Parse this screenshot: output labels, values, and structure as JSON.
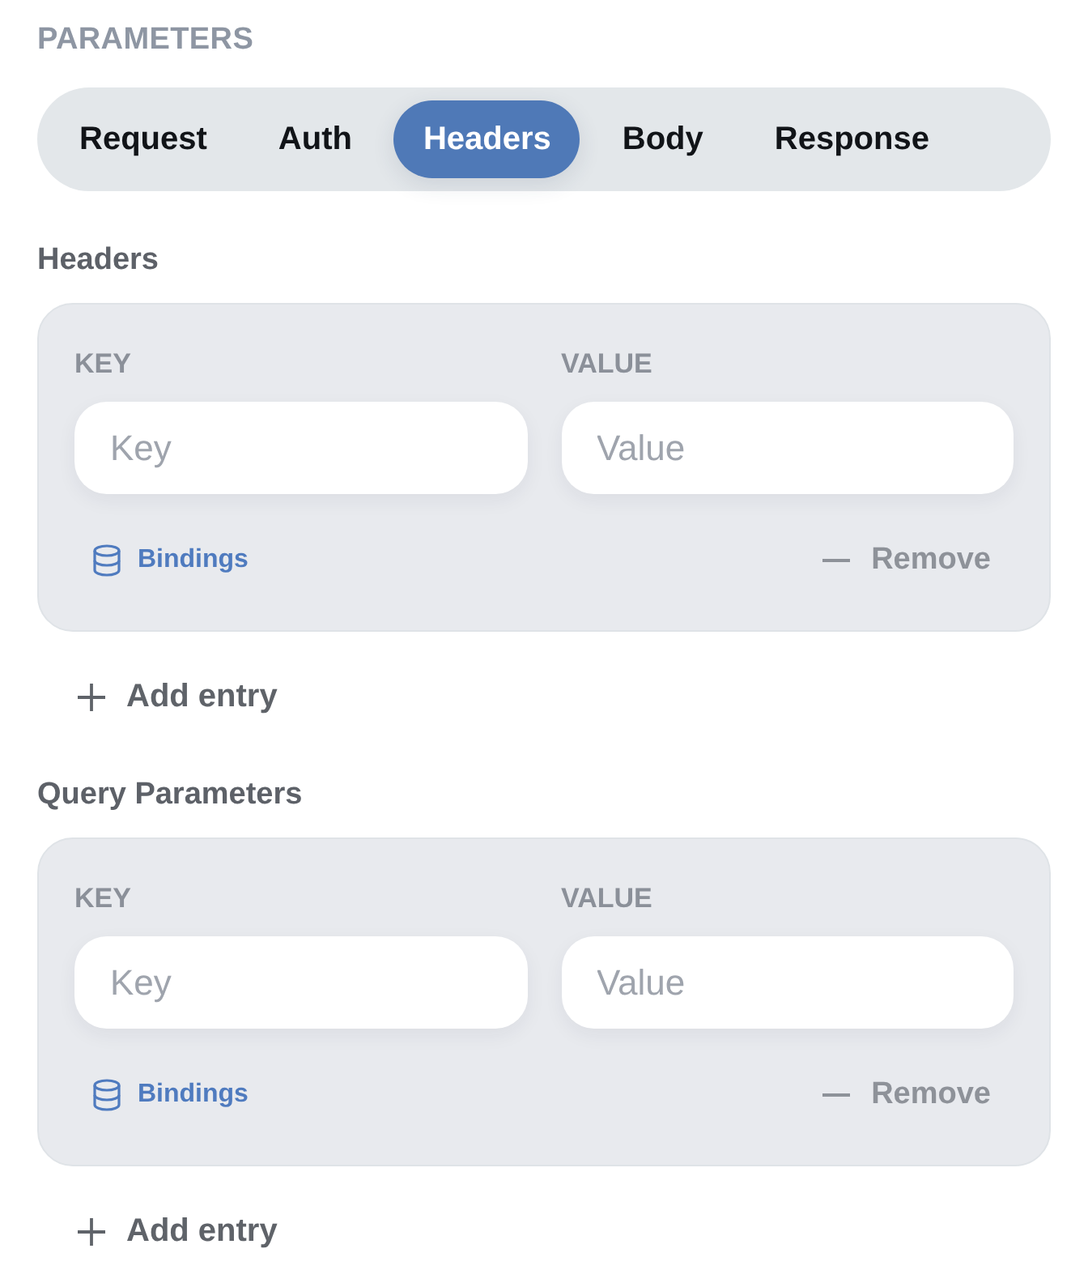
{
  "section_title": "PARAMETERS",
  "tabs": [
    {
      "label": "Request",
      "selected": false
    },
    {
      "label": "Auth",
      "selected": false
    },
    {
      "label": "Headers",
      "selected": true
    },
    {
      "label": "Body",
      "selected": false
    },
    {
      "label": "Response",
      "selected": false
    }
  ],
  "groups": [
    {
      "title": "Headers",
      "entries": [
        {
          "key_label": "KEY",
          "value_label": "VALUE",
          "key_field": {
            "placeholder": "Key"
          },
          "value_field": {
            "placeholder": "Value"
          },
          "bindings_link": "Bindings",
          "remove_button": "Remove"
        }
      ],
      "add_button": "Add entry"
    },
    {
      "title": "Query Parameters",
      "entries": [
        {
          "key_label": "KEY",
          "value_label": "VALUE",
          "key_field": {
            "placeholder": "Key"
          },
          "value_field": {
            "placeholder": "Value"
          },
          "bindings_link": "Bindings",
          "remove_button": "Remove"
        }
      ],
      "add_button": "Add entry"
    }
  ]
}
